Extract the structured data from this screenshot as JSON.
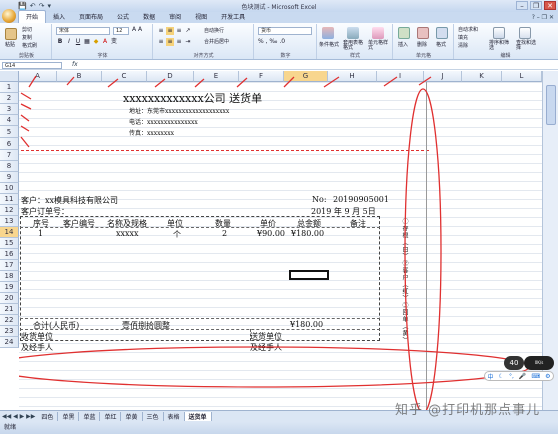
{
  "window": {
    "title": "色块测试 - Microsoft Excel",
    "qat": [
      "💾",
      "↶",
      "↷",
      "▾"
    ],
    "controls": [
      "–",
      "❐",
      "✕"
    ]
  },
  "tabs": [
    "开始",
    "插入",
    "页面布局",
    "公式",
    "数据",
    "审阅",
    "视图",
    "开发工具"
  ],
  "ribbon": {
    "clipboard": {
      "paste": "粘贴",
      "cut": "剪切",
      "copy": "复制",
      "painter": "格式刷",
      "group": "剪贴板"
    },
    "font": {
      "name": "宋体",
      "size": "12",
      "group": "字体"
    },
    "alignment": {
      "wrap": "自动换行",
      "merge": "合并后居中",
      "group": "对齐方式"
    },
    "number": {
      "format": "货币",
      "group": "数字"
    },
    "styles": {
      "cond": "条件格式",
      "table": "套用表格格式",
      "cell": "单元格样式",
      "group": "样式"
    },
    "cells": {
      "insert": "插入",
      "delete": "删除",
      "format": "格式",
      "group": "单元格"
    },
    "editing": {
      "autosum": "自动求和",
      "fill": "填充",
      "clear": "清除",
      "sort": "排序和筛选",
      "find": "查找和选择",
      "group": "编辑"
    }
  },
  "formula": {
    "namebox": "G14",
    "fx": "fx"
  },
  "columns": [
    "A",
    "B",
    "C",
    "D",
    "E",
    "F",
    "G",
    "H",
    "I",
    "J",
    "K",
    "L"
  ],
  "rows": [
    "1",
    "2",
    "3",
    "4",
    "5",
    "6",
    "7",
    "8",
    "9",
    "10",
    "11",
    "12",
    "13",
    "14",
    "15",
    "16",
    "17",
    "18",
    "19",
    "20",
    "21",
    "22",
    "23",
    "24"
  ],
  "doc": {
    "title": "xxxxxxxxxxxxx公司 送货单",
    "address": "地址：东莞市xxxxxxxxxxxxxxxxxxx",
    "phone": "电话：xxxxxxxxxxxxxxx",
    "fax": "传真：xxxxxxxx",
    "customer": "客户：xx模具科技有限公司",
    "order_no": "客户订单号：",
    "no_label": "No:",
    "no_value": "20190905001",
    "date": "2019 年 9 月 5日",
    "headers": [
      "序号",
      "客户编号",
      "名称及规格",
      "单位",
      "数量",
      "单价",
      "总金额",
      "备注"
    ],
    "row": {
      "seq": "1",
      "name": "xxxxx",
      "unit": "个",
      "qty": "2",
      "price": "¥90.00",
      "total": "¥180.00"
    },
    "total_label": "合计(人民币)",
    "total_words": "壹佰捌拾圆整",
    "total_value": "¥180.00",
    "recv_unit": "收货单位",
    "recv_person": "及经手人",
    "send_unit": "送货单位",
    "send_person": "及经手人",
    "side_note": "①存根（白）②客户（红）③回单（黄）"
  },
  "sheet_tabs": [
    "四色",
    "单黑",
    "单蓝",
    "单红",
    "单黄",
    "三色",
    "表格",
    "送货单"
  ],
  "status": "就绪",
  "watermark": "知乎 @打印机那点事儿",
  "ime": {
    "badge": "40",
    "speed": "0K/s",
    "label": "中"
  }
}
